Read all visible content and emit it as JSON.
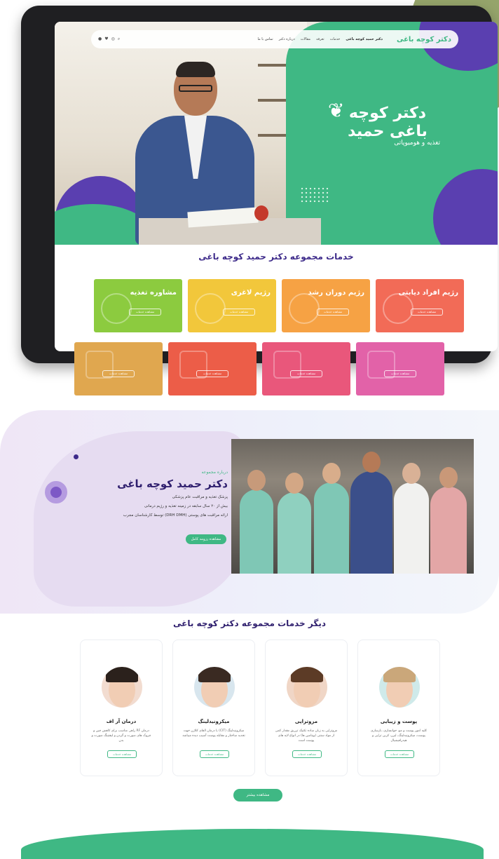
{
  "nav": {
    "logo": "دکتر کوچه باغی",
    "items": [
      "دکتر حمید کوچه باغی",
      "خدمات",
      "تعرفه",
      "مقالات",
      "درباره دکتر",
      "تماس با ما"
    ],
    "icons": [
      "search-icon",
      "instagram-icon",
      "twitter-icon",
      "whatsapp-icon"
    ]
  },
  "hero": {
    "logo_name": "دکتر کوچه باغی حمید",
    "logo_sub": "تغذیه و هومیوپاتی"
  },
  "services": {
    "title": "خدمات مجموعه دکتر حمید کوچه باغی",
    "tiles": [
      {
        "name": "مشاوره تغذیه",
        "button": "مشاهده خدمات",
        "color": "#8ccb3f"
      },
      {
        "name": "رژیم لاغری",
        "button": "مشاهده خدمات",
        "color": "#f2c73b"
      },
      {
        "name": "رژیم دوران رشد",
        "button": "مشاهده خدمات",
        "color": "#f6a244"
      },
      {
        "name": "رژیم افراد دیابتی",
        "button": "مشاهده خدمات",
        "color": "#f26b57"
      }
    ],
    "tiles_row2": [
      {
        "button": "مشاهده خدمات",
        "color": "#e0a74f"
      },
      {
        "button": "مشاهده خدمات",
        "color": "#ec5d48"
      },
      {
        "button": "مشاهده خدمات",
        "color": "#e9577b"
      },
      {
        "button": "مشاهده خدمات",
        "color": "#e262a8"
      }
    ]
  },
  "about": {
    "kicker": "درباره مجموعه",
    "name": "دکتر حمید کوچه باغی",
    "lines": [
      "پزشک تغذیه و مراقبت عام پزشکی",
      "بیش از ۲۰ سال سابقه در زمینه تغذیه و رژیم درمانی",
      "ارائه مراقبت های پوستی (DRH DMH) توسط کارشناسان مجرب"
    ],
    "button": "مشاهده رزومه کامل"
  },
  "other": {
    "title": "دیگر خدمات مجموعه دکتر کوچه باغی",
    "cards": [
      {
        "name": "پوست و زیبایی",
        "desc": "کلیه امور پوست و مو، جوانسازی، بازسازی پوست، میکرونیدلینگ، لیزر، کربن تراپی و هیدرافیشیال",
        "button": "مشاهده خدمات"
      },
      {
        "name": "مزوتراپی",
        "desc": "مزوتراپی به زبان ساده تکنیک تزریق مقدار کمی از مواد سنتی (ویتامین ها) در انواع لایه های پوست است",
        "button": "مشاهده خدمات"
      },
      {
        "name": "میکرونیدلینگ",
        "desc": "میکرونیدلینگ (CIT) یا درمان القای کلاژن جهت تجدید ساختار و مقابله پوست آسیب دیده میباشد",
        "button": "مشاهده خدمات"
      },
      {
        "name": "درمان آر اف",
        "desc": "درمان RF راهی مناسب برای کاهش چین و چروک های صورت و گردن و لیفتینگ صورت و بدن",
        "button": "مشاهده خدمات"
      }
    ]
  },
  "more_button": "مشاهده بیشتر",
  "colors": {
    "green": "#3fb884",
    "purple": "#5a3fb0",
    "navy": "#2f1f6e"
  }
}
